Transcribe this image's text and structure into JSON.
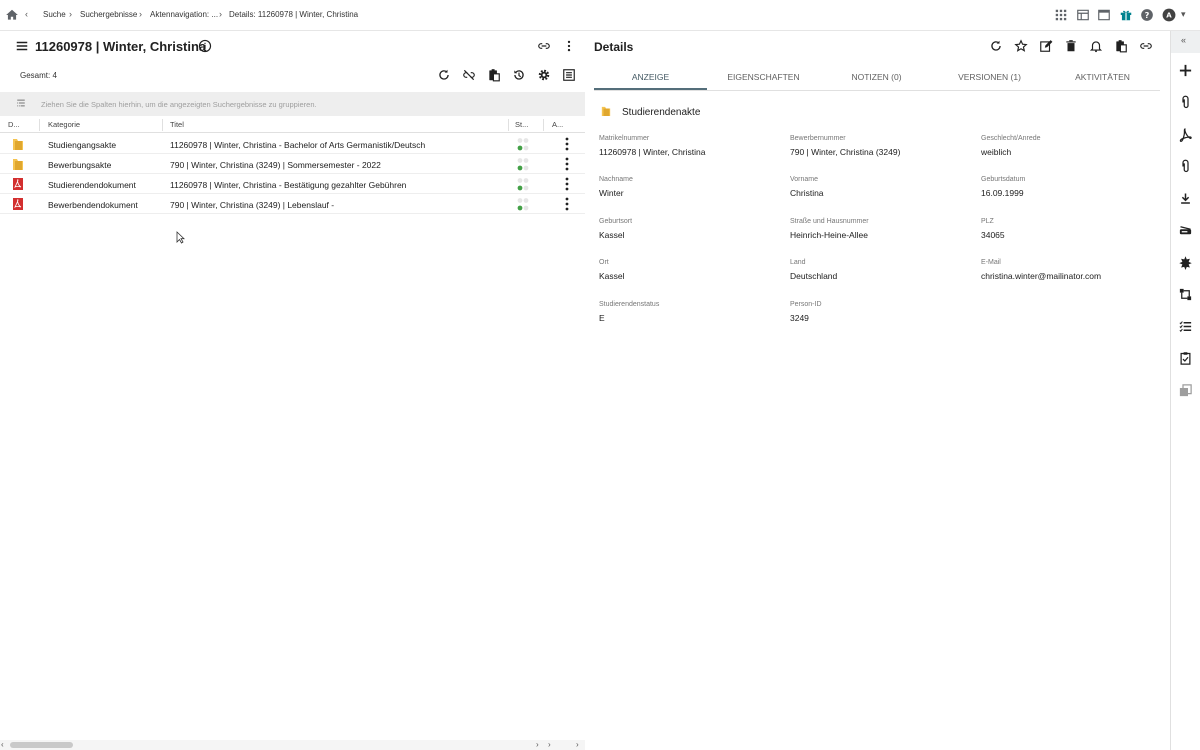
{
  "breadcrumb": {
    "items": [
      "Suche",
      "Suchergebnisse",
      "Aktennavigation: ...",
      "Details: 11260978 | Winter, Christina"
    ]
  },
  "left": {
    "title": "11260978 | Winter, Christina",
    "total_label": "Gesamt: 4",
    "group_hint": "Ziehen Sie die Spalten hierhin, um die angezeigten Suchergebnisse zu gruppieren.",
    "columns": [
      "D...",
      "Kategorie",
      "Titel",
      "St...",
      "A..."
    ],
    "rows": [
      {
        "kategorie": "Studiengangsakte",
        "titel": "11260978 | Winter, Christina - Bachelor of Arts Germanistik/Deutsch",
        "icon": "folder-icon"
      },
      {
        "kategorie": "Bewerbungsakte",
        "titel": "790 | Winter, Christina (3249) | Sommersemester - 2022",
        "icon": "folder-icon"
      },
      {
        "kategorie": "Studierendendokument",
        "titel": "11260978 | Winter, Christina - Bestätigung gezahlter Gebühren",
        "icon": "pdf-icon"
      },
      {
        "kategorie": "Bewerbendendokument",
        "titel": "790 | Winter, Christina (3249) | Lebenslauf -",
        "icon": "pdf-icon"
      }
    ]
  },
  "details": {
    "title": "Details",
    "tabs": [
      "ANZEIGE",
      "EIGENSCHAFTEN",
      "NOTIZEN (0)",
      "VERSIONEN (1)",
      "AKTIVITÄTEN"
    ],
    "active_tab": "ANZEIGE",
    "section_title": "Studierendenakte",
    "fields": [
      {
        "label": "Matrikelnummer",
        "value": "11260978 | Winter, Christina"
      },
      {
        "label": "Bewerbernummer",
        "value": "790 | Winter, Christina (3249)"
      },
      {
        "label": "Geschlecht/Anrede",
        "value": "weiblich"
      },
      {
        "label": "Nachname",
        "value": "Winter"
      },
      {
        "label": "Vorname",
        "value": "Christina"
      },
      {
        "label": "Geburtsdatum",
        "value": "16.09.1999"
      },
      {
        "label": "Geburtsort",
        "value": "Kassel"
      },
      {
        "label": "Straße und Hausnummer",
        "value": "Heinrich-Heine-Allee"
      },
      {
        "label": "PLZ",
        "value": "34065"
      },
      {
        "label": "Ort",
        "value": "Kassel"
      },
      {
        "label": "Land",
        "value": "Deutschland"
      },
      {
        "label": "E-Mail",
        "value": "christina.winter@mailinator.com"
      },
      {
        "label": "Studierendenstatus",
        "value": "E"
      },
      {
        "label": "Person-ID",
        "value": "3249"
      }
    ]
  },
  "sidebar": {
    "collapse_label": "«"
  },
  "colors": {
    "folder": "#f5c451",
    "pdf": "#d32f2f",
    "status_green": "#43a047",
    "tab_active": "#546e7a"
  }
}
